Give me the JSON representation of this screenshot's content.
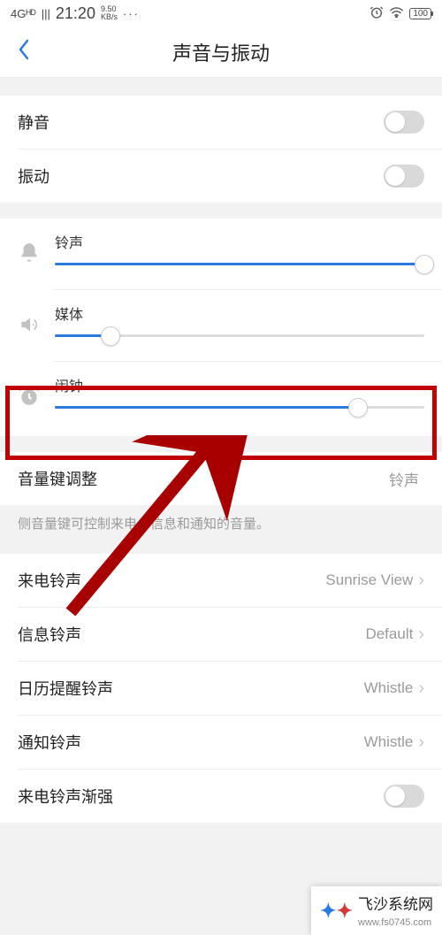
{
  "status": {
    "network": "4Gᴴᴰ",
    "signal": "|||",
    "time": "21:20",
    "speed_top": "9.50",
    "speed_bottom": "KB/s",
    "dots": "···",
    "alarm": "⏰",
    "wifi": "ᯤ",
    "battery": "100"
  },
  "header": {
    "title": "声音与振动",
    "back": "‹"
  },
  "toggles": {
    "mute": "静音",
    "vibrate": "振动"
  },
  "sliders": {
    "ring": {
      "label": "铃声",
      "percent": 100
    },
    "media": {
      "label": "媒体",
      "percent": 15
    },
    "alarm": {
      "label": "闹钟",
      "percent": 82
    }
  },
  "volume_key": {
    "label": "音量键调整",
    "value": "铃声",
    "hint": "侧音量键可控制来电、信息和通知的音量。"
  },
  "ringtones": {
    "incoming": {
      "label": "来电铃声",
      "value": "Sunrise View"
    },
    "message": {
      "label": "信息铃声",
      "value": "Default"
    },
    "calendar": {
      "label": "日历提醒铃声",
      "value": "Whistle"
    },
    "notify": {
      "label": "通知铃声",
      "value": "Whistle"
    },
    "ascend": {
      "label": "来电铃声渐强"
    }
  },
  "watermark": {
    "brand": "飞沙系统网",
    "url": "www.fs0745.com"
  }
}
